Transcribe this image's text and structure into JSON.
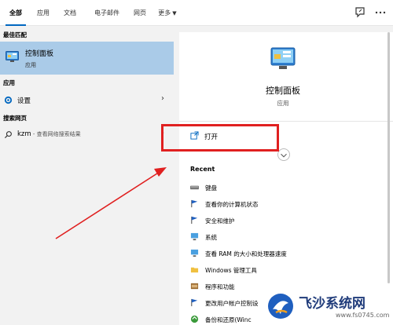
{
  "tabs": [
    "全部",
    "应用",
    "文档",
    "电子邮件",
    "网页",
    "更多"
  ],
  "left": {
    "best_match_header": "最佳匹配",
    "best_match": {
      "name": "控制面板",
      "type": "应用"
    },
    "apps_header": "应用",
    "settings_label": "设置",
    "web_header": "搜索网页",
    "web_query": "kzm",
    "web_hint": " - 查看网络搜索结果"
  },
  "right": {
    "title": "控制面板",
    "subtitle": "应用",
    "open_label": "打开",
    "recent_header": "Recent",
    "recent": [
      "键盘",
      "查看你的计算机状态",
      "安全和维护",
      "系统",
      "查看 RAM 的大小和处理器速度",
      "Windows 管理工具",
      "程序和功能",
      "更改用户帐户控制设",
      "备份和还原(Winc"
    ]
  },
  "watermark": {
    "title": "飞沙系统网",
    "url": "www.fs0745.com"
  },
  "colors": {
    "selected": "#aacbe8",
    "accent": "#0067c0",
    "annotation": "#e02020"
  }
}
